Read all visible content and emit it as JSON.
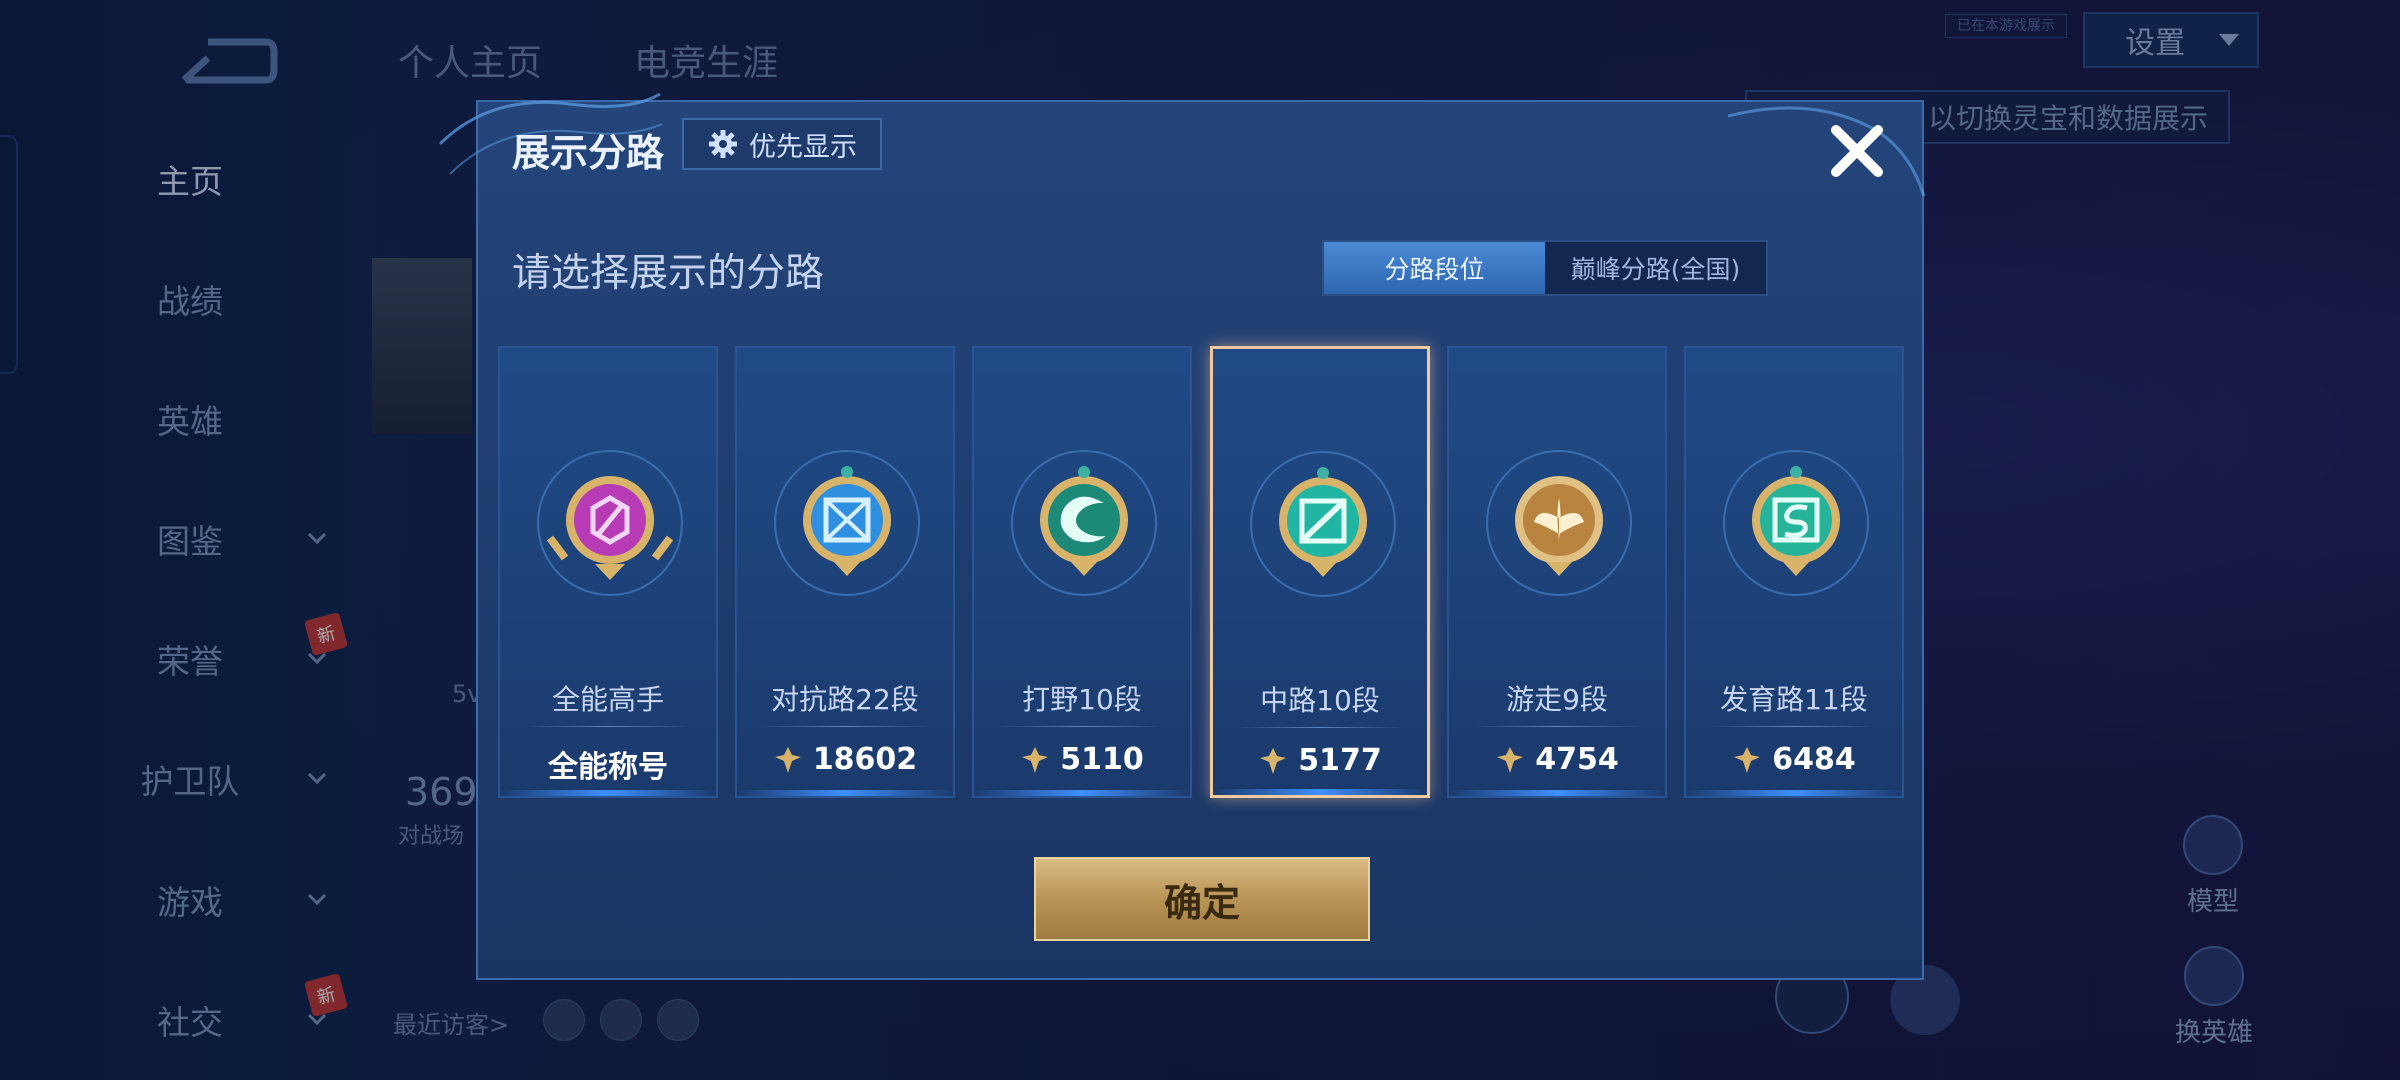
{
  "nav": {
    "items": [
      {
        "label": "主页",
        "active": true,
        "chevron": false,
        "badge": ""
      },
      {
        "label": "战绩",
        "active": false,
        "chevron": false,
        "badge": ""
      },
      {
        "label": "英雄",
        "active": false,
        "chevron": false,
        "badge": ""
      },
      {
        "label": "图鉴",
        "active": false,
        "chevron": true,
        "badge": ""
      },
      {
        "label": "荣誉",
        "active": false,
        "chevron": true,
        "badge": "新"
      },
      {
        "label": "护卫队",
        "active": false,
        "chevron": true,
        "badge": ""
      },
      {
        "label": "游戏",
        "active": false,
        "chevron": true,
        "badge": ""
      },
      {
        "label": "社交",
        "active": false,
        "chevron": true,
        "badge": "新"
      }
    ]
  },
  "page": {
    "tabs": [
      "个人主页",
      "电竞生涯"
    ],
    "settings_label": "设置",
    "tag_label": "已在本游戏展示",
    "hint_text": "以切换灵宝和数据展示",
    "stat_value": "369",
    "stat_label": "对战场",
    "stat_side": "5v",
    "visitors_label": "最近访客>",
    "model_label": "模型",
    "swap_label": "换英雄"
  },
  "modal": {
    "title": "展示分路",
    "priority_label": "优先显示",
    "subtitle": "请选择展示的分路",
    "segment": {
      "options": [
        "分路段位",
        "巅峰分路(全国)"
      ],
      "selected": "分路段位"
    },
    "cards": [
      {
        "label": "全能高手",
        "value": "全能称号",
        "has_points": false,
        "selected": false,
        "emblem": "allround-emblem-icon",
        "accent": "#b63bb5"
      },
      {
        "label": "对抗路22段",
        "value": "18602",
        "has_points": true,
        "selected": false,
        "emblem": "clash-lane-emblem-icon",
        "accent": "#2f8fe0"
      },
      {
        "label": "打野10段",
        "value": "5110",
        "has_points": true,
        "selected": false,
        "emblem": "jungle-emblem-icon",
        "accent": "#1d8a78"
      },
      {
        "label": "中路10段",
        "value": "5177",
        "has_points": true,
        "selected": true,
        "emblem": "mid-lane-emblem-icon",
        "accent": "#21b6a4"
      },
      {
        "label": "游走9段",
        "value": "4754",
        "has_points": true,
        "selected": false,
        "emblem": "roam-emblem-icon",
        "accent": "#c6954a"
      },
      {
        "label": "发育路11段",
        "value": "6484",
        "has_points": true,
        "selected": false,
        "emblem": "farm-lane-emblem-icon",
        "accent": "#25b39a"
      }
    ],
    "confirm_label": "确定"
  }
}
